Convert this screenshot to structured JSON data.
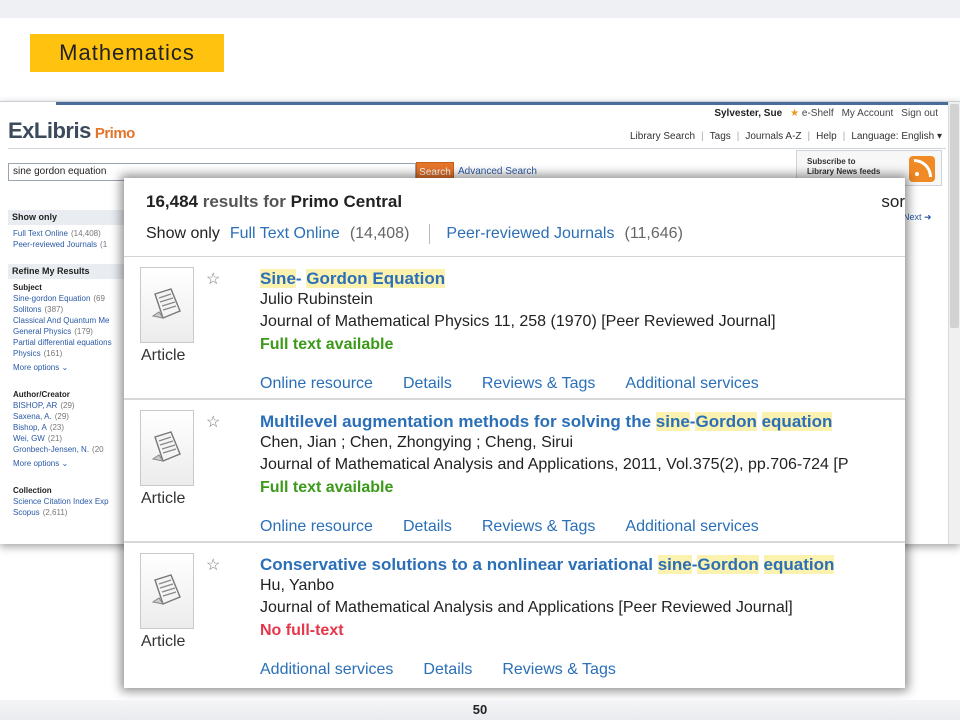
{
  "slide": {
    "title": "Mathematics",
    "page_number": "50"
  },
  "primo": {
    "user": "Sylvester, Sue",
    "eshelf": "e-Shelf",
    "my_account": "My Account",
    "sign_out": "Sign out",
    "logo_text": "ExLibris",
    "logo_product": "Primo",
    "nav": [
      "Library Search",
      "Tags",
      "Journals A-Z",
      "Help"
    ],
    "language_label": "Language:",
    "language_value": "English",
    "search_query": "sine gordon equation",
    "search_button": "Search",
    "advanced_search": "Advanced Search",
    "news_line1": "Subscribe to",
    "news_line2": "Library News feeds",
    "next_label": "Next",
    "sidebar": {
      "show_only_title": "Show only",
      "show_only_items": [
        {
          "label": "Full Text Online",
          "count": "(14,408)"
        },
        {
          "label": "Peer-reviewed Journals",
          "count": "(1"
        }
      ],
      "refine_title": "Refine My Results",
      "subject_title": "Subject",
      "subject_items": [
        {
          "label": "Sine-gordon Equation",
          "count": "(69"
        },
        {
          "label": "Solitons",
          "count": "(387)"
        },
        {
          "label": "Classical And Quantum Me",
          "count": ""
        },
        {
          "label": "General Physics",
          "count": "(179)"
        },
        {
          "label": "Partial differential equations",
          "count": ""
        },
        {
          "label": "Physics",
          "count": "(161)"
        }
      ],
      "more_options": "More options",
      "author_title": "Author/Creator",
      "author_items": [
        {
          "label": "BISHOP, AR",
          "count": "(29)"
        },
        {
          "label": "Saxena, A.",
          "count": "(29)"
        },
        {
          "label": "Bishop, A",
          "count": "(23)"
        },
        {
          "label": "Wei, GW",
          "count": "(21)"
        },
        {
          "label": "Gronbech-Jensen, N.",
          "count": "(20"
        }
      ],
      "collection_title": "Collection",
      "collection_items": [
        {
          "label": "Science Citation Index Exp",
          "count": ""
        },
        {
          "label": "Scopus",
          "count": "(2,611)"
        }
      ]
    }
  },
  "results": {
    "count": "16,484",
    "results_for": "results for",
    "source": "Primo Central",
    "sort_peek": "sor",
    "show_only_label": "Show only",
    "filters": [
      {
        "label": "Full Text Online",
        "count": "(14,408)"
      },
      {
        "label": "Peer-reviewed Journals",
        "count": "(11,646)"
      }
    ],
    "records": [
      {
        "type": "Article",
        "title_parts": [
          {
            "text": "Sine",
            "hl": true
          },
          {
            "text": "- ",
            "hl": false
          },
          {
            "text": "Gordon Equation",
            "hl": true
          }
        ],
        "author": "Julio Rubinstein",
        "source": "Journal of Mathematical Physics 11, 258 (1970) [Peer Reviewed Journal]",
        "availability": "Full text available",
        "available": true,
        "actions": [
          "Online resource",
          "Details",
          "Reviews & Tags",
          "Additional services"
        ]
      },
      {
        "type": "Article",
        "title_parts": [
          {
            "text": "Multilevel augmentation methods for solving the ",
            "hl": false
          },
          {
            "text": "sine",
            "hl": true
          },
          {
            "text": "-",
            "hl": false
          },
          {
            "text": "Gordon",
            "hl": true
          },
          {
            "text": " ",
            "hl": false
          },
          {
            "text": "equation",
            "hl": true
          }
        ],
        "author": "Chen, Jian ; Chen, Zhongying ; Cheng, Sirui",
        "source": "Journal of Mathematical Analysis and Applications, 2011, Vol.375(2), pp.706-724 [P",
        "availability": "Full text available",
        "available": true,
        "actions": [
          "Online resource",
          "Details",
          "Reviews & Tags",
          "Additional services"
        ]
      },
      {
        "type": "Article",
        "title_parts": [
          {
            "text": "Conservative solutions to a nonlinear variational ",
            "hl": false
          },
          {
            "text": "sine",
            "hl": true
          },
          {
            "text": "-",
            "hl": false
          },
          {
            "text": "Gordon",
            "hl": true
          },
          {
            "text": " ",
            "hl": false
          },
          {
            "text": "equation",
            "hl": true
          }
        ],
        "author": "Hu, Yanbo",
        "source": "Journal of Mathematical Analysis and Applications [Peer Reviewed Journal]",
        "availability": "No full-text",
        "available": false,
        "actions": [
          "Additional services",
          "Details",
          "Reviews & Tags"
        ]
      }
    ]
  },
  "icons": {
    "star": "star-outline-icon",
    "document": "document-icon",
    "rss": "rss-feed-icon",
    "chevron": "chevron-down-icon",
    "next_arrow": "arrow-right-icon"
  }
}
